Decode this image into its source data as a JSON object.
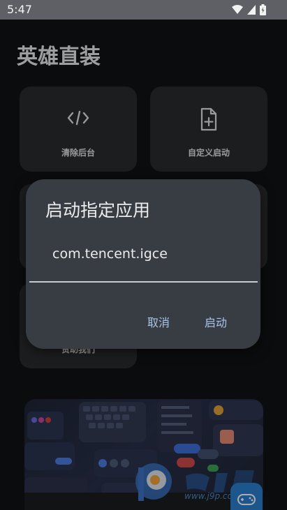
{
  "status_bar": {
    "time": "5:47",
    "icons": [
      "wifi-icon",
      "signal-icon",
      "battery-icon"
    ]
  },
  "app": {
    "title": "英雄直装"
  },
  "tiles": [
    {
      "label": "清除后台",
      "icon": "code-icon"
    },
    {
      "label": "自定义启动",
      "icon": "file-add-icon"
    },
    {
      "label": "赞助我们",
      "icon": ""
    }
  ],
  "dialog": {
    "title": "启动指定应用",
    "input_value": "com.tencent.igce",
    "cancel_label": "取消",
    "launch_label": "启动"
  },
  "watermark": {
    "url": "www.j9p.com"
  },
  "colors": {
    "dialog_bg": "#383d44",
    "accent_button_text": "#a9c4e8",
    "tile_bg": "#2a2b2e",
    "fab": "#2c7fd0"
  }
}
